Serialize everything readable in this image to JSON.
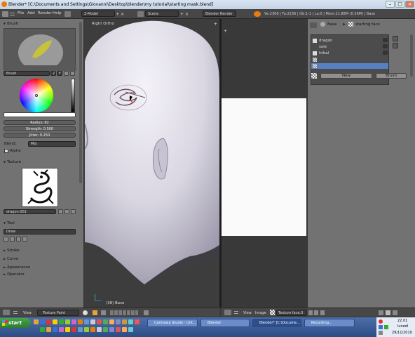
{
  "window": {
    "title": "Blender* [C:\\Documents and Settings\\Giovanni\\Desktop\\blender\\my tutorial\\starting mask.blend]"
  },
  "info_header": {
    "menus": [
      "File",
      "Add",
      "Render",
      "Help"
    ],
    "screen_layout": "2-Model",
    "scene": "Scene",
    "engine": "Blender Render",
    "stats": "Ve:2306 | Fa:2236 | Ob:1-1 | La:0 | Mem:21.88M (0.56M) | Base"
  },
  "tool_panel": {
    "brush_section": "Brush",
    "brush_name": "Brush",
    "brush_users": "2",
    "brush_fake_user": "F",
    "radius": "Radius: 82",
    "strength": "Strength: 0.500",
    "jitter": "Jitter: 0.250",
    "blend_label": "Blend:",
    "blend_value": "Mix",
    "alpha_label": "Alpha",
    "texture_section": "Texture",
    "texture_name": "dragon.001",
    "tool_section": "Tool",
    "tool_value": "Draw",
    "stroke_section": "Stroke",
    "curve_section": "Curve",
    "appearance_section": "Appearance",
    "operator_section": "Operator"
  },
  "viewport": {
    "view_label": "Right Ortho",
    "object_label": "(38) Base"
  },
  "properties": {
    "breadcrumb_object": "Base",
    "breadcrumb_texture": "starting face",
    "texture_slots": [
      "dragon",
      "sole",
      "tribal",
      "",
      ""
    ],
    "new_button": "New",
    "brush_button": "Brush"
  },
  "bottom_headers": {
    "view3d": {
      "view_menu": "View",
      "mode": "Texture Paint"
    },
    "image_editor": {
      "view_menu": "View",
      "image_menu": "Image",
      "image_name": "Texture face.0"
    }
  },
  "taskbar": {
    "start_label": "start",
    "tasks": [
      "Camtasia Studio - Unt...",
      "Blender",
      "Blender* [C:\\Docume...",
      "Recording..."
    ],
    "tray_time": "22.01",
    "tray_day": "lunedì",
    "tray_date": "29/11/2010"
  },
  "colors": {
    "accent_orange": "#e87d0d",
    "selected_slot": "#5680c2",
    "start_green": "#3b9440"
  }
}
